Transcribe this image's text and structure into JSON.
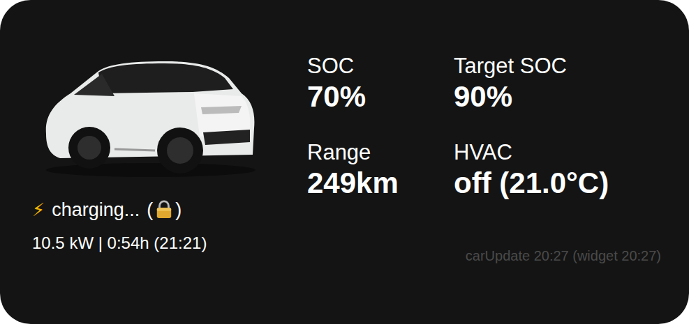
{
  "vehicle": {
    "status": {
      "icon": "⚡",
      "label": "charging...",
      "lock": {
        "open": "(",
        "close": ")",
        "locked": true
      }
    },
    "charging": "10.5 kW | 0:54h (21:21)"
  },
  "metrics": [
    {
      "label": "SOC",
      "value": "70%"
    },
    {
      "label": "Target SOC",
      "value": "90%"
    },
    {
      "label": "Range",
      "value": "249km"
    },
    {
      "label": "HVAC",
      "value": "off (21.0°C)"
    }
  ],
  "footer": "carUpdate 20:27 (widget 20:27)"
}
